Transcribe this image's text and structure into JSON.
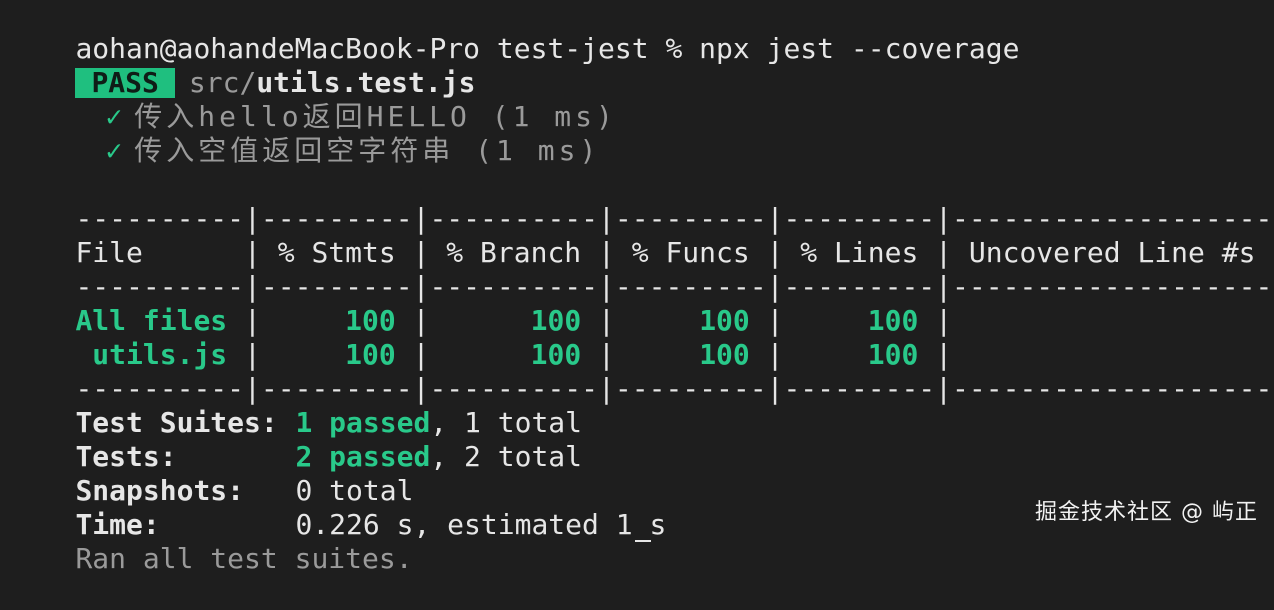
{
  "prompt": {
    "text": "aohan@aohandeMacBook-Pro test-jest % npx jest --coverage"
  },
  "result": {
    "status_badge": "PASS",
    "path_prefix": "src/",
    "file": "utils.test.js"
  },
  "tests": [
    {
      "check": "✓",
      "name": "传入hello返回HELLO (1 ms)"
    },
    {
      "check": "✓",
      "name": "传入空值返回空字符串 (1 ms)"
    }
  ],
  "coverage": {
    "separator": "----------|---------|----------|---------|---------|-------------------",
    "header": "File      | % Stmts | % Branch | % Funcs | % Lines | Uncovered Line #s ",
    "rows": [
      {
        "name": "All files",
        "stmts": "100",
        "branch": "100",
        "funcs": "100",
        "lines": "100"
      },
      {
        "name": " utils.js",
        "stmts": "100",
        "branch": "100",
        "funcs": "100",
        "lines": "100"
      }
    ]
  },
  "summary": {
    "suites_label": "Test Suites:",
    "suites_passed": "1 passed",
    "suites_total": ", 1 total",
    "tests_label": "Tests:",
    "tests_passed": "2 passed",
    "tests_total": ", 2 total",
    "snapshots_label": "Snapshots:",
    "snapshots_value": "0 total",
    "time_label": "Time:",
    "time_value": "0.226 s, estimated 1 s",
    "footer": "Ran all test suites."
  },
  "watermark": "掘金技术社区 @ 屿正"
}
